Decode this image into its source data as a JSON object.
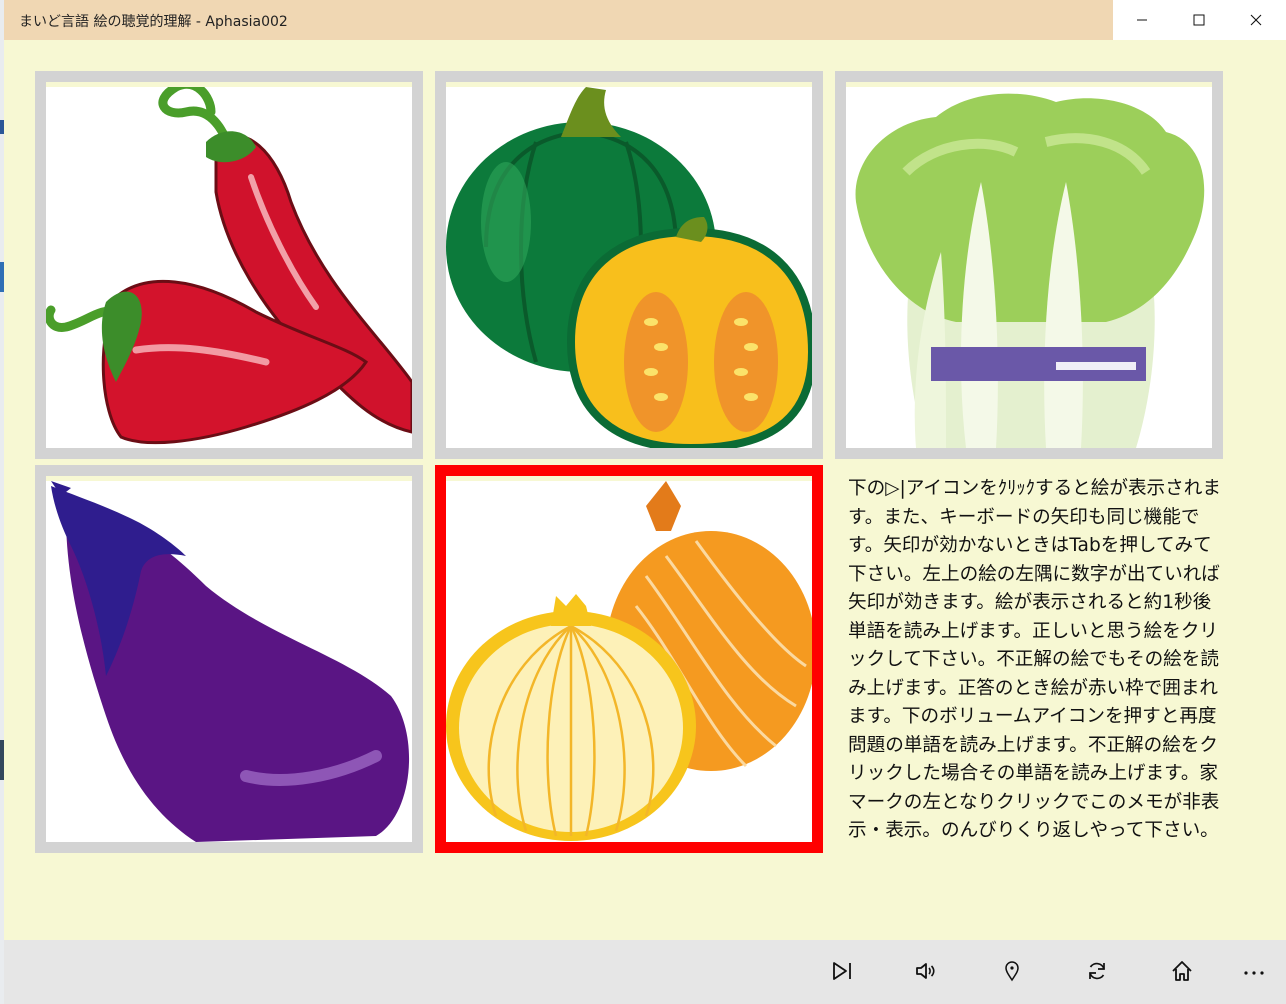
{
  "window": {
    "title": "まいど言語 絵の聴覚的理解 - Aphasia002"
  },
  "tiles": [
    {
      "name": "chili-peppers",
      "selected": false
    },
    {
      "name": "pumpkin",
      "selected": false
    },
    {
      "name": "chinese-cabbage",
      "selected": false
    },
    {
      "name": "eggplant",
      "selected": false
    },
    {
      "name": "onion",
      "selected": true
    }
  ],
  "memo": {
    "text": "下の▷|アイコンをｸﾘｯｸすると絵が表示されます。また、キーボードの矢印も同じ機能です。矢印が効かないときはTabを押してみて下さい。左上の絵の左隅に数字が出ていれば矢印が効きます。絵が表示されると約1秒後単語を読み上げます。正しいと思う絵をクリックして下さい。不正解の絵でもその絵を読み上げます。正答のとき絵が赤い枠で囲まれます。下のボリュームアイコンを押すと再度問題の単語を読み上げます。不正解の絵をクリックした場合その単語を読み上げます。家マークの左となりクリックでこのメモが非表示・表示。のんびりくり返しやって下さい。"
  },
  "appbar": {
    "buttons": [
      "next-icon",
      "volume-icon",
      "location-icon",
      "refresh-icon",
      "home-icon",
      "more-icon"
    ],
    "more_label": "..."
  },
  "colors": {
    "background": "#f7f8d3",
    "titlebar": "#f0d7b3",
    "tile_border": "#d3d3d3",
    "selected_border": "#ff0000",
    "appbar": "#e6e6e6"
  }
}
